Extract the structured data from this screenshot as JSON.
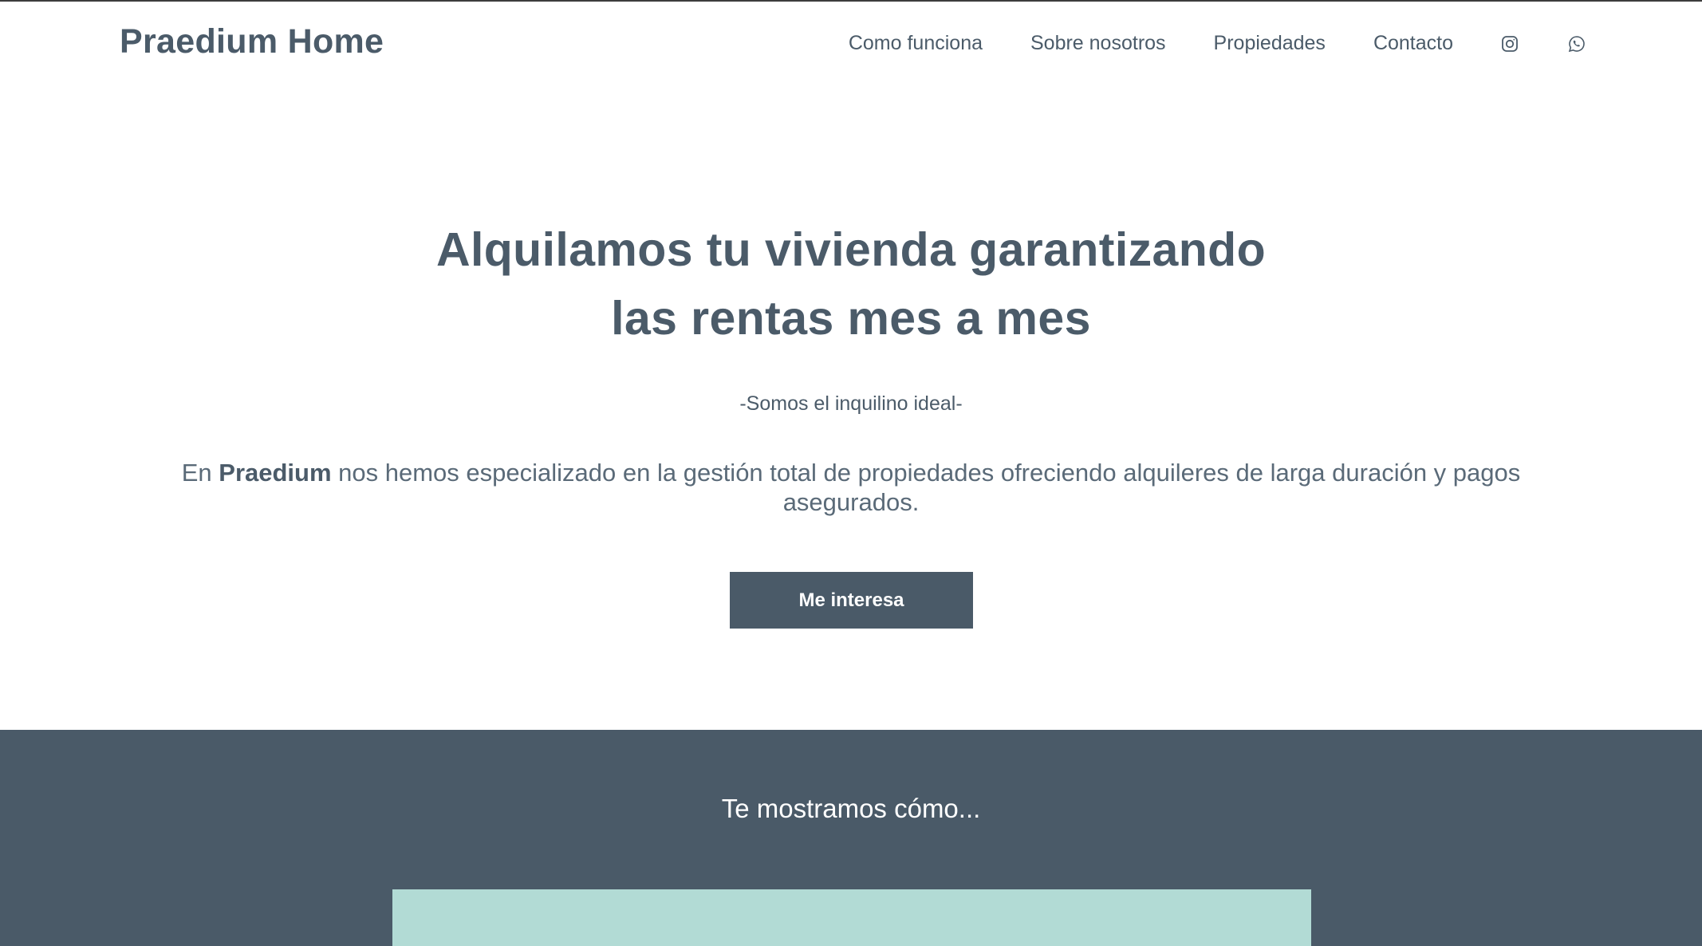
{
  "header": {
    "brand": "Praedium Home",
    "nav": [
      "Como funciona",
      "Sobre nosotros",
      "Propiedades",
      "Contacto"
    ],
    "social_icons": [
      "instagram-icon",
      "whatsapp-icon"
    ]
  },
  "hero": {
    "title_line1": "Alquilamos tu vivienda garantizando",
    "title_line2": "las rentas mes a mes",
    "tagline": "-Somos el inquilino ideal-",
    "desc_prefix": "En ",
    "desc_brand": "Praedium",
    "desc_suffix": " nos hemos especializado en la gestión total de propiedades ofreciendo alquileres de larga duración y pagos asegurados.",
    "cta_label": "Me interesa"
  },
  "section": {
    "heading": "Te mostramos cómo..."
  },
  "colors": {
    "primary": "#4a5a68",
    "teal": "#b2dbd5",
    "white": "#ffffff"
  }
}
